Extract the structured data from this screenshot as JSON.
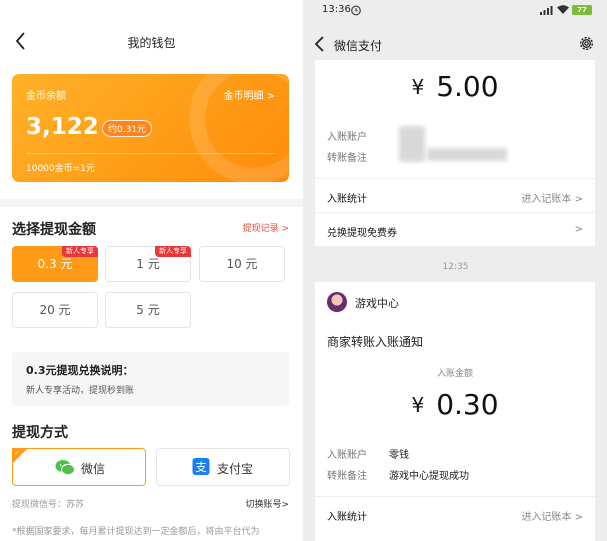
{
  "left": {
    "header_title": "我的钱包",
    "card": {
      "label": "金币余额",
      "detail_link": "金币明细 >",
      "balance": "3,122",
      "rmb": "约0.31元",
      "rate": "10000金币=1元"
    },
    "select_title": "选择提现金额",
    "record_link": "提现记录 >",
    "amounts": [
      {
        "label": "0.3 元",
        "badge": "新人专享"
      },
      {
        "label": "1 元",
        "badge": "新人专享"
      },
      {
        "label": "10 元",
        "badge": ""
      },
      {
        "label": "20 元",
        "badge": ""
      },
      {
        "label": "5 元",
        "badge": ""
      }
    ],
    "note_title": "0.3元提现兑换说明：",
    "note_text": "新人专享活动，提现秒到账",
    "method_title": "提现方式",
    "methods": [
      {
        "label": "微信"
      },
      {
        "label": "支付宝"
      }
    ],
    "account_label": "提现微信号：苏苏",
    "switch_link": "切换账号>",
    "footer_note": "*根据国家要求，每月累计提现达到一定金额后，将由平台代为"
  },
  "right": {
    "status": {
      "time": "13:36",
      "battery": "77"
    },
    "header_title": "微信支付",
    "tx1": {
      "yen": "¥",
      "amount": "5.00",
      "account_label": "入账账户",
      "memo_label": "转账备注",
      "stats_label": "入账统计",
      "stats_link": "进入记账本 >",
      "coupon_label": "兑换提现免费券",
      "coupon_arrow": ">"
    },
    "divider_time": "12:35",
    "tx2": {
      "app_name": "游戏中心",
      "notice_title": "商家转账入账通知",
      "amount_label": "入账金额",
      "yen": "¥",
      "amount": "0.30",
      "account_label": "入账账户",
      "account_value": "零钱",
      "memo_label": "转账备注",
      "memo_value": "游戏中心提现成功",
      "stats_label": "入账统计",
      "stats_link": "进入记账本 >"
    }
  },
  "colors": {
    "accent_orange": "#ff9b16",
    "badge_red": "#e8383a",
    "wechat_green": "#4fc14a",
    "alipay_blue": "#1a7ff0"
  }
}
